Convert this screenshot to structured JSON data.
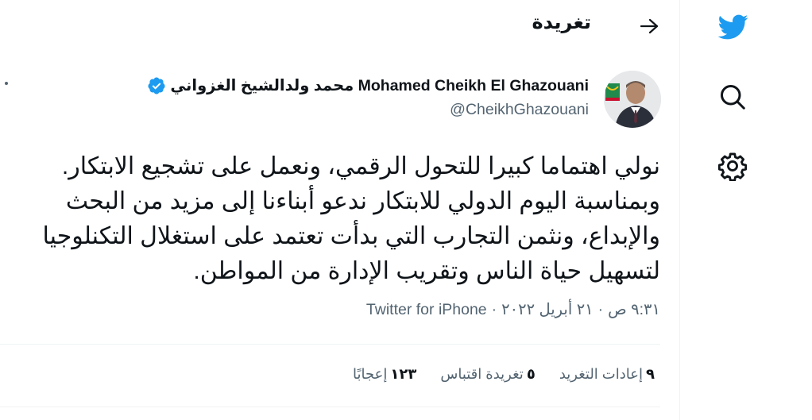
{
  "header": {
    "title": "تغريدة"
  },
  "author": {
    "display_name": "Mohamed Cheikh El Ghazouani محمد ولدالشيخ الغزواني",
    "handle": "@CheikhGhazouani",
    "verified": true
  },
  "tweet": {
    "text": "نولي اهتماما كبيرا للتحول الرقمي، ونعمل على تشجيع الابتكار.\nوبمناسبة اليوم الدولي للابتكار ندعو أبناءنا  إلى مزيد من البحث\nوالإبداع، ونثمن التجارب التي بدأت تعتمد على استغلال التكنلوجيا\nلتسهيل حياة الناس وتقريب الإدارة من المواطن.",
    "time": "٩:٣١ ص",
    "date": "٢١ أبريل ٢٠٢٢",
    "source": "Twitter for iPhone",
    "separator": "·"
  },
  "stats": {
    "retweets_count": "٩",
    "retweets_label": "إعادات التغريد",
    "quotes_count": "٥",
    "quotes_label": "تغريدة اقتباس",
    "likes_count": "١٢٣",
    "likes_label": "إعجابًا"
  },
  "nav": {
    "icons": [
      "twitter-logo-icon",
      "search-icon",
      "settings-gear-icon"
    ]
  },
  "colors": {
    "brand_blue": "#1d9bf0",
    "text_primary": "#0f1419",
    "text_secondary": "#536471",
    "divider": "#eff3f4"
  }
}
